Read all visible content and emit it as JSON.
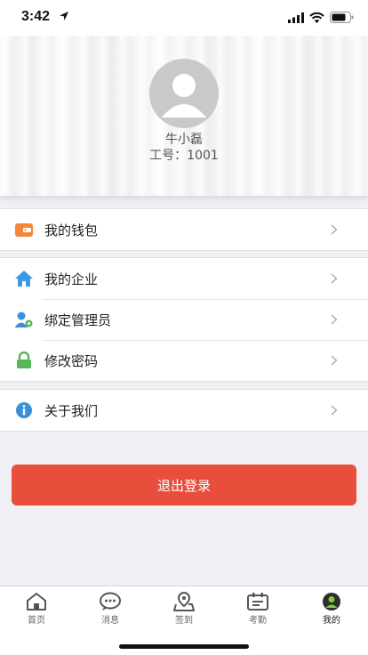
{
  "status_bar": {
    "time": "3:42"
  },
  "profile": {
    "name": "牛小磊",
    "id_label": "工号：",
    "id_value": "1001"
  },
  "menu": {
    "wallet": "我的钱包",
    "enterprise": "我的企业",
    "bind_admin": "绑定管理员",
    "change_password": "修改密码",
    "about": "关于我们"
  },
  "logout_label": "退出登录",
  "tabs": [
    {
      "label": "首页",
      "icon": "home-icon"
    },
    {
      "label": "消息",
      "icon": "message-icon"
    },
    {
      "label": "签到",
      "icon": "location-pin-icon"
    },
    {
      "label": "考勤",
      "icon": "calendar-icon"
    },
    {
      "label": "我的",
      "icon": "profile-icon"
    }
  ],
  "colors": {
    "accent_red": "#e94e3c",
    "wallet_orange": "#f0873a",
    "home_blue": "#3d9ae0",
    "lock_green": "#5ab55a",
    "info_blue": "#3a8fd6"
  }
}
